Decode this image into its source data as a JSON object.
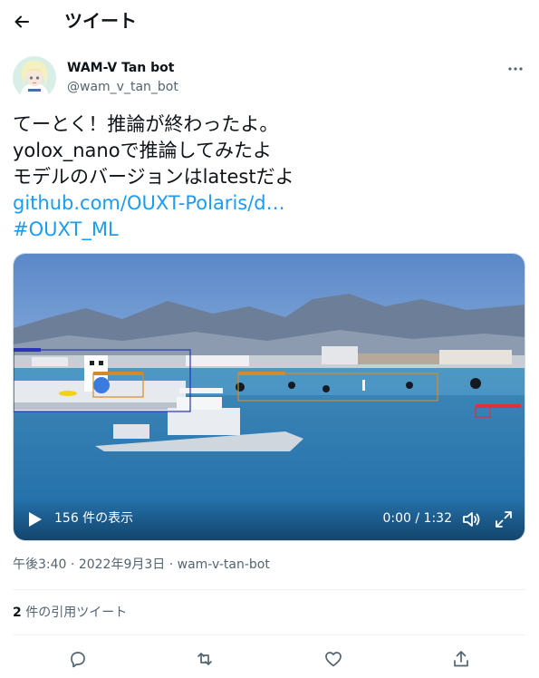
{
  "header": {
    "title": "ツイート"
  },
  "author": {
    "display_name": "WAM-V Tan bot",
    "handle": "@wam_v_tan_bot"
  },
  "tweet": {
    "line1": "てーとく！推論が終わったよ。",
    "line2": "yolox_nanoで推論してみたよ",
    "line3": "モデルのバージョンはlatestだよ",
    "link": "github.com/OUXT-Polaris/d…",
    "hashtag": "#OUXT_ML"
  },
  "media": {
    "views": "156 件の表示",
    "time": "0:00 / 1:32"
  },
  "meta": {
    "time": "午後3:40",
    "sep1": " · ",
    "date": "2022年9月3日",
    "sep2": " · ",
    "source": "wam-v-tan-bot"
  },
  "stats": {
    "quote_count": "2",
    "quote_label": " 件の引用ツイート"
  },
  "colors": {
    "accent": "#1d9bf0",
    "text": "#0f1419",
    "secondary": "#536471",
    "border": "#eff3f4"
  },
  "icons": [
    "back-arrow-icon",
    "more-icon",
    "play-icon",
    "volume-icon",
    "fullscreen-icon",
    "reply-icon",
    "retweet-icon",
    "like-icon",
    "share-icon"
  ]
}
